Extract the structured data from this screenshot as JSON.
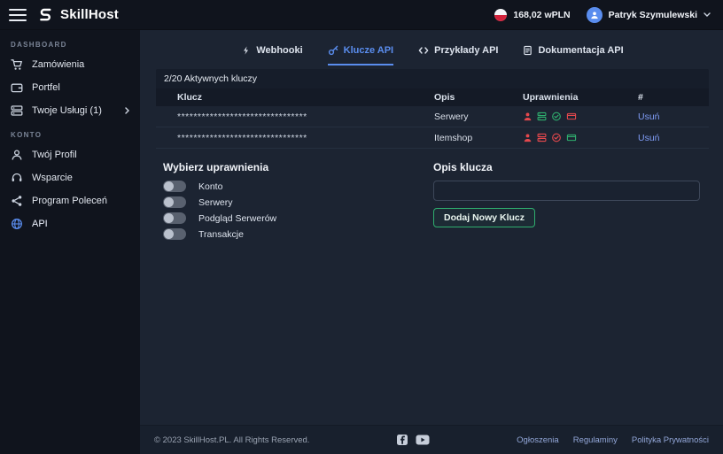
{
  "colors": {
    "accent": "#5a8dee",
    "granted": "#2fae6e",
    "denied": "#e5484d"
  },
  "header": {
    "brand": "SkillHost",
    "balance": "168,02 wPLN",
    "user_name": "Patryk Szymulewski"
  },
  "sidebar": {
    "sections": [
      {
        "label": "DASHBOARD",
        "items": [
          {
            "label": "Zamówienia",
            "icon": "cart-icon"
          },
          {
            "label": "Portfel",
            "icon": "wallet-icon"
          },
          {
            "label": "Twoje Usługi (1)",
            "icon": "services-icon",
            "chevron": true
          }
        ]
      },
      {
        "label": "KONTO",
        "items": [
          {
            "label": "Twój Profil",
            "icon": "user-icon"
          },
          {
            "label": "Wsparcie",
            "icon": "support-icon"
          },
          {
            "label": "Program Poleceń",
            "icon": "referral-icon"
          },
          {
            "label": "API",
            "icon": "api-icon",
            "active": true
          }
        ]
      }
    ]
  },
  "tabs": [
    {
      "label": "Webhooki",
      "icon": "webhook-icon",
      "active": false
    },
    {
      "label": "Klucze API",
      "icon": "key-icon",
      "active": true
    },
    {
      "label": "Przykłady API",
      "icon": "code-icon",
      "active": false
    },
    {
      "label": "Dokumentacja API",
      "icon": "docs-icon",
      "active": false
    }
  ],
  "api_keys": {
    "count_text": "2/20 Aktywnych kluczy",
    "columns": [
      "Klucz",
      "Opis",
      "Uprawnienia",
      "#"
    ],
    "rows": [
      {
        "key_masked": "********************************",
        "opis": "Serwery",
        "permissions": [
          "denied",
          "granted",
          "granted",
          "denied"
        ],
        "action_label": "Usuń"
      },
      {
        "key_masked": "********************************",
        "opis": "Itemshop",
        "permissions": [
          "denied",
          "denied",
          "denied",
          "granted"
        ],
        "action_label": "Usuń"
      }
    ]
  },
  "permissions_form": {
    "title": "Wybierz uprawnienia",
    "toggles": [
      {
        "label": "Konto",
        "state": "off"
      },
      {
        "label": "Serwery",
        "state": "off"
      },
      {
        "label": "Podgląd Serwerów",
        "state": "off"
      },
      {
        "label": "Transakcje",
        "state": "off"
      }
    ]
  },
  "key_form": {
    "title": "Opis klucza",
    "input_value": "",
    "submit_label": "Dodaj Nowy Klucz"
  },
  "footer": {
    "copyright": "© 2023 SkillHost.PL. All Rights Reserved.",
    "links": [
      "Ogłoszenia",
      "Regulaminy",
      "Polityka Prywatności"
    ]
  }
}
